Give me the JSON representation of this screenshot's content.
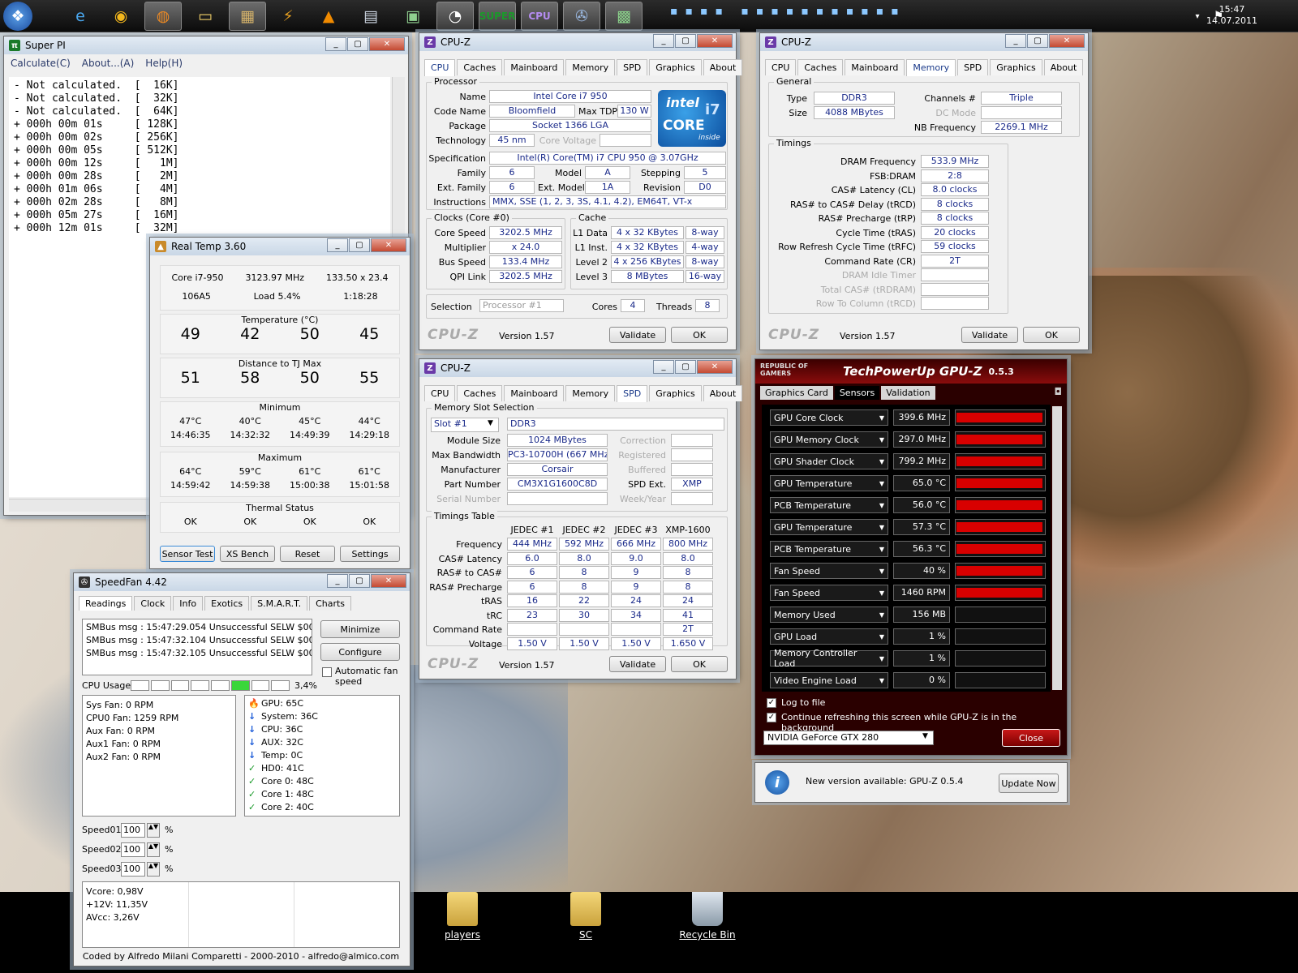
{
  "clock": {
    "time": "15:47",
    "date": "14.07.2011"
  },
  "desktop_icons": [
    {
      "label": "players"
    },
    {
      "label": "SC"
    },
    {
      "label": "Recycle Bin"
    }
  ],
  "superpi": {
    "title": "Super PI",
    "menu": [
      "Calculate(C)",
      "About...(A)",
      "Help(H)"
    ],
    "lines": [
      "- Not calculated.  [  16K]",
      "- Not calculated.  [  32K]",
      "- Not calculated.  [  64K]",
      "+ 000h 00m 01s     [ 128K]",
      "+ 000h 00m 02s     [ 256K]",
      "+ 000h 00m 05s     [ 512K]",
      "+ 000h 00m 12s     [   1M]",
      "+ 000h 00m 28s     [   2M]",
      "+ 000h 01m 06s     [   4M]",
      "+ 000h 02m 28s     [   8M]",
      "+ 000h 05m 27s     [  16M]",
      "+ 000h 12m 01s     [  32M]"
    ]
  },
  "cpuz_common": {
    "title": "CPU-Z",
    "logo": "CPU-Z",
    "version": "Version 1.57",
    "validate": "Validate",
    "ok": "OK",
    "tabs": [
      "CPU",
      "Caches",
      "Mainboard",
      "Memory",
      "SPD",
      "Graphics",
      "About"
    ]
  },
  "cpuz_cpu": {
    "processor_group": "Processor",
    "name_lbl": "Name",
    "name": "Intel Core i7 950",
    "codename_lbl": "Code Name",
    "codename": "Bloomfield",
    "maxtdp_lbl": "Max TDP",
    "maxtdp": "130 W",
    "package_lbl": "Package",
    "package": "Socket 1366 LGA",
    "tech_lbl": "Technology",
    "tech": "45 nm",
    "corevolt_lbl": "Core Voltage",
    "spec_lbl": "Specification",
    "spec": "Intel(R) Core(TM) i7 CPU       950  @ 3.07GHz",
    "family_lbl": "Family",
    "family": "6",
    "model_lbl": "Model",
    "model": "A",
    "stepping_lbl": "Stepping",
    "stepping": "5",
    "extfamily_lbl": "Ext. Family",
    "extfamily": "6",
    "extmodel_lbl": "Ext. Model",
    "extmodel": "1A",
    "revision_lbl": "Revision",
    "revision": "D0",
    "instr_lbl": "Instructions",
    "instr": "MMX, SSE (1, 2, 3, 3S, 4.1, 4.2), EM64T, VT-x",
    "clocks_group": "Clocks (Core #0)",
    "corespeed_lbl": "Core Speed",
    "corespeed": "3202.5 MHz",
    "mult_lbl": "Multiplier",
    "mult": "x 24.0",
    "bus_lbl": "Bus Speed",
    "bus": "133.4 MHz",
    "qpi_lbl": "QPI Link",
    "qpi": "3202.5 MHz",
    "cache_group": "Cache",
    "l1d_lbl": "L1 Data",
    "l1d": "4 x 32 KBytes",
    "l1d_w": "8-way",
    "l1i_lbl": "L1 Inst.",
    "l1i": "4 x 32 KBytes",
    "l1i_w": "4-way",
    "l2_lbl": "Level 2",
    "l2": "4 x 256 KBytes",
    "l2_w": "8-way",
    "l3_lbl": "Level 3",
    "l3": "8 MBytes",
    "l3_w": "16-way",
    "selection_lbl": "Selection",
    "selection": "Processor #1",
    "cores_lbl": "Cores",
    "cores": "4",
    "threads_lbl": "Threads",
    "threads": "8",
    "intel_logo": {
      "brand": "intel",
      "line": "CORE",
      "model": "i7",
      "tag": "inside"
    }
  },
  "cpuz_mem": {
    "general_group": "General",
    "type_lbl": "Type",
    "type": "DDR3",
    "size_lbl": "Size",
    "size": "4088 MBytes",
    "channels_lbl": "Channels #",
    "channels": "Triple",
    "dcmode_lbl": "DC Mode",
    "nbfreq_lbl": "NB Frequency",
    "nbfreq": "2269.1 MHz",
    "timings_group": "Timings",
    "rows": [
      {
        "label": "DRAM Frequency",
        "value": "533.9 MHz"
      },
      {
        "label": "FSB:DRAM",
        "value": "2:8"
      },
      {
        "label": "CAS# Latency (CL)",
        "value": "8.0 clocks"
      },
      {
        "label": "RAS# to CAS# Delay (tRCD)",
        "value": "8 clocks"
      },
      {
        "label": "RAS# Precharge (tRP)",
        "value": "8 clocks"
      },
      {
        "label": "Cycle Time (tRAS)",
        "value": "20 clocks"
      },
      {
        "label": "Row Refresh Cycle Time (tRFC)",
        "value": "59 clocks"
      },
      {
        "label": "Command Rate (CR)",
        "value": "2T"
      },
      {
        "label": "DRAM Idle Timer",
        "value": ""
      },
      {
        "label": "Total CAS# (tRDRAM)",
        "value": ""
      },
      {
        "label": "Row To Column (tRCD)",
        "value": ""
      }
    ]
  },
  "cpuz_spd": {
    "slot_group": "Memory Slot Selection",
    "slot": "Slot #1",
    "slot_type": "DDR3",
    "modsize_lbl": "Module Size",
    "modsize": "1024 MBytes",
    "maxbw_lbl": "Max Bandwidth",
    "maxbw": "PC3-10700H (667 MHz)",
    "manuf_lbl": "Manufacturer",
    "manuf": "Corsair",
    "part_lbl": "Part Number",
    "part": "CM3X1G1600C8D",
    "serial_lbl": "Serial Number",
    "correction_lbl": "Correction",
    "registered_lbl": "Registered",
    "buffered_lbl": "Buffered",
    "spdext_lbl": "SPD Ext.",
    "spdext": "XMP",
    "week_lbl": "Week/Year",
    "timings_group": "Timings Table",
    "cols": [
      "JEDEC #1",
      "JEDEC #2",
      "JEDEC #3",
      "XMP-1600"
    ],
    "rows": [
      {
        "label": "Frequency",
        "v": [
          "444 MHz",
          "592 MHz",
          "666 MHz",
          "800 MHz"
        ]
      },
      {
        "label": "CAS# Latency",
        "v": [
          "6.0",
          "8.0",
          "9.0",
          "8.0"
        ]
      },
      {
        "label": "RAS# to CAS#",
        "v": [
          "6",
          "8",
          "9",
          "8"
        ]
      },
      {
        "label": "RAS# Precharge",
        "v": [
          "6",
          "8",
          "9",
          "8"
        ]
      },
      {
        "label": "tRAS",
        "v": [
          "16",
          "22",
          "24",
          "24"
        ]
      },
      {
        "label": "tRC",
        "v": [
          "23",
          "30",
          "34",
          "41"
        ]
      },
      {
        "label": "Command Rate",
        "v": [
          "",
          "",
          "",
          "2T"
        ]
      },
      {
        "label": "Voltage",
        "v": [
          "1.50 V",
          "1.50 V",
          "1.50 V",
          "1.650 V"
        ]
      }
    ]
  },
  "realtemp": {
    "title": "Real Temp 3.60",
    "cpu": "Core i7-950",
    "freq": "3123.97 MHz",
    "mult": "133.50 x 23.4",
    "id": "106A5",
    "load": "Load  5.4%",
    "uptime": "1:18:28",
    "temp_cap": "Temperature (°C)",
    "temps": [
      "49",
      "42",
      "50",
      "45"
    ],
    "dist_cap": "Distance to TJ Max",
    "dists": [
      "51",
      "58",
      "50",
      "55"
    ],
    "min_cap": "Minimum",
    "min_t": [
      "47°C",
      "40°C",
      "45°C",
      "44°C"
    ],
    "min_time": [
      "14:46:35",
      "14:32:32",
      "14:49:39",
      "14:29:18"
    ],
    "max_cap": "Maximum",
    "max_t": [
      "64°C",
      "59°C",
      "61°C",
      "61°C"
    ],
    "max_time": [
      "14:59:42",
      "14:59:38",
      "15:00:38",
      "15:01:58"
    ],
    "thermal_cap": "Thermal Status",
    "thermal": [
      "OK",
      "OK",
      "OK",
      "OK"
    ],
    "buttons": [
      "Sensor Test",
      "XS Bench",
      "Reset",
      "Settings"
    ]
  },
  "speedfan": {
    "title": "SpeedFan 4.42",
    "tabs": [
      "Readings",
      "Clock",
      "Info",
      "Exotics",
      "S.M.A.R.T.",
      "Charts"
    ],
    "log": [
      "SMBus msg : 15:47:29.054 Unsuccessful SELW $00 to $",
      "SMBus msg : 15:47:32.104 Unsuccessful SELW $00 to $",
      "SMBus msg : 15:47:32.105 Unsuccessful SELW $00 to $"
    ],
    "minimize": "Minimize",
    "configure": "Configure",
    "autofan": "Automatic fan speed",
    "cpu_usage_lbl": "CPU Usage",
    "cpu_usage": "3,4%",
    "cpu_usage_frac": 0.034,
    "fans": [
      "Sys Fan:     0 RPM",
      "CPU0 Fan: 1259 RPM",
      "Aux Fan:     0 RPM",
      "Aux1 Fan:    0 RPM",
      "Aux2 Fan:    0 RPM"
    ],
    "temps": [
      {
        "icon": "flame-icon",
        "text": "GPU:    65C"
      },
      {
        "icon": "arrow-down-icon",
        "text": "System: 36C"
      },
      {
        "icon": "arrow-down-icon",
        "text": "CPU:    36C"
      },
      {
        "icon": "arrow-down-icon",
        "text": "AUX:    32C"
      },
      {
        "icon": "arrow-down-icon",
        "text": "Temp:   0C"
      },
      {
        "icon": "check-icon",
        "text": "HD0:    41C"
      },
      {
        "icon": "check-icon",
        "text": "Core 0: 48C"
      },
      {
        "icon": "check-icon",
        "text": "Core 1: 48C"
      },
      {
        "icon": "check-icon",
        "text": "Core 2: 40C"
      }
    ],
    "speeds": [
      {
        "label": "Speed01:",
        "value": "100"
      },
      {
        "label": "Speed02:",
        "value": "100"
      },
      {
        "label": "Speed03:",
        "value": "100"
      }
    ],
    "pct": "%",
    "volts": [
      "Vcore:   0,98V",
      "+12V:   11,35V",
      "AVcc:    3,26V"
    ],
    "footer": "Coded by Alfredo Milani Comparetti - 2000-2010 - alfredo@almico.com"
  },
  "gpuz": {
    "title": "TechPowerUp GPU-Z",
    "ver": "0.5.3",
    "rog": "REPUBLIC OF GAMERS",
    "tabs": [
      "Graphics Card",
      "Sensors",
      "Validation"
    ],
    "sensors": [
      {
        "name": "GPU Core Clock",
        "value": "399.6 MHz",
        "fill": 0.98
      },
      {
        "name": "GPU Memory Clock",
        "value": "297.0 MHz",
        "fill": 0.98
      },
      {
        "name": "GPU Shader Clock",
        "value": "799.2 MHz",
        "fill": 0.98
      },
      {
        "name": "GPU Temperature",
        "value": "65.0 °C",
        "fill": 0.98
      },
      {
        "name": "PCB Temperature",
        "value": "56.0 °C",
        "fill": 0.98
      },
      {
        "name": "GPU Temperature",
        "value": "57.3 °C",
        "fill": 0.98
      },
      {
        "name": "PCB Temperature",
        "value": "56.3 °C",
        "fill": 0.98
      },
      {
        "name": "Fan Speed",
        "value": "40 %",
        "fill": 0.98
      },
      {
        "name": "Fan Speed",
        "value": "1460 RPM",
        "fill": 0.98
      },
      {
        "name": "Memory Used",
        "value": "156 MB",
        "fill": 0
      },
      {
        "name": "GPU Load",
        "value": "1 %",
        "fill": 0
      },
      {
        "name": "Memory Controller Load",
        "value": "1 %",
        "fill": 0
      },
      {
        "name": "Video Engine Load",
        "value": "0 %",
        "fill": 0
      }
    ],
    "logfile": "Log to file",
    "refresh": "Continue refreshing this screen while GPU-Z is in the background",
    "card": "NVIDIA GeForce GTX 280",
    "close": "Close",
    "update_msg": "New version available: GPU-Z 0.5.4",
    "update_btn": "Update Now"
  },
  "colors": {
    "gpuz_bar": "#d80000",
    "accent": "#1a2a8a"
  }
}
